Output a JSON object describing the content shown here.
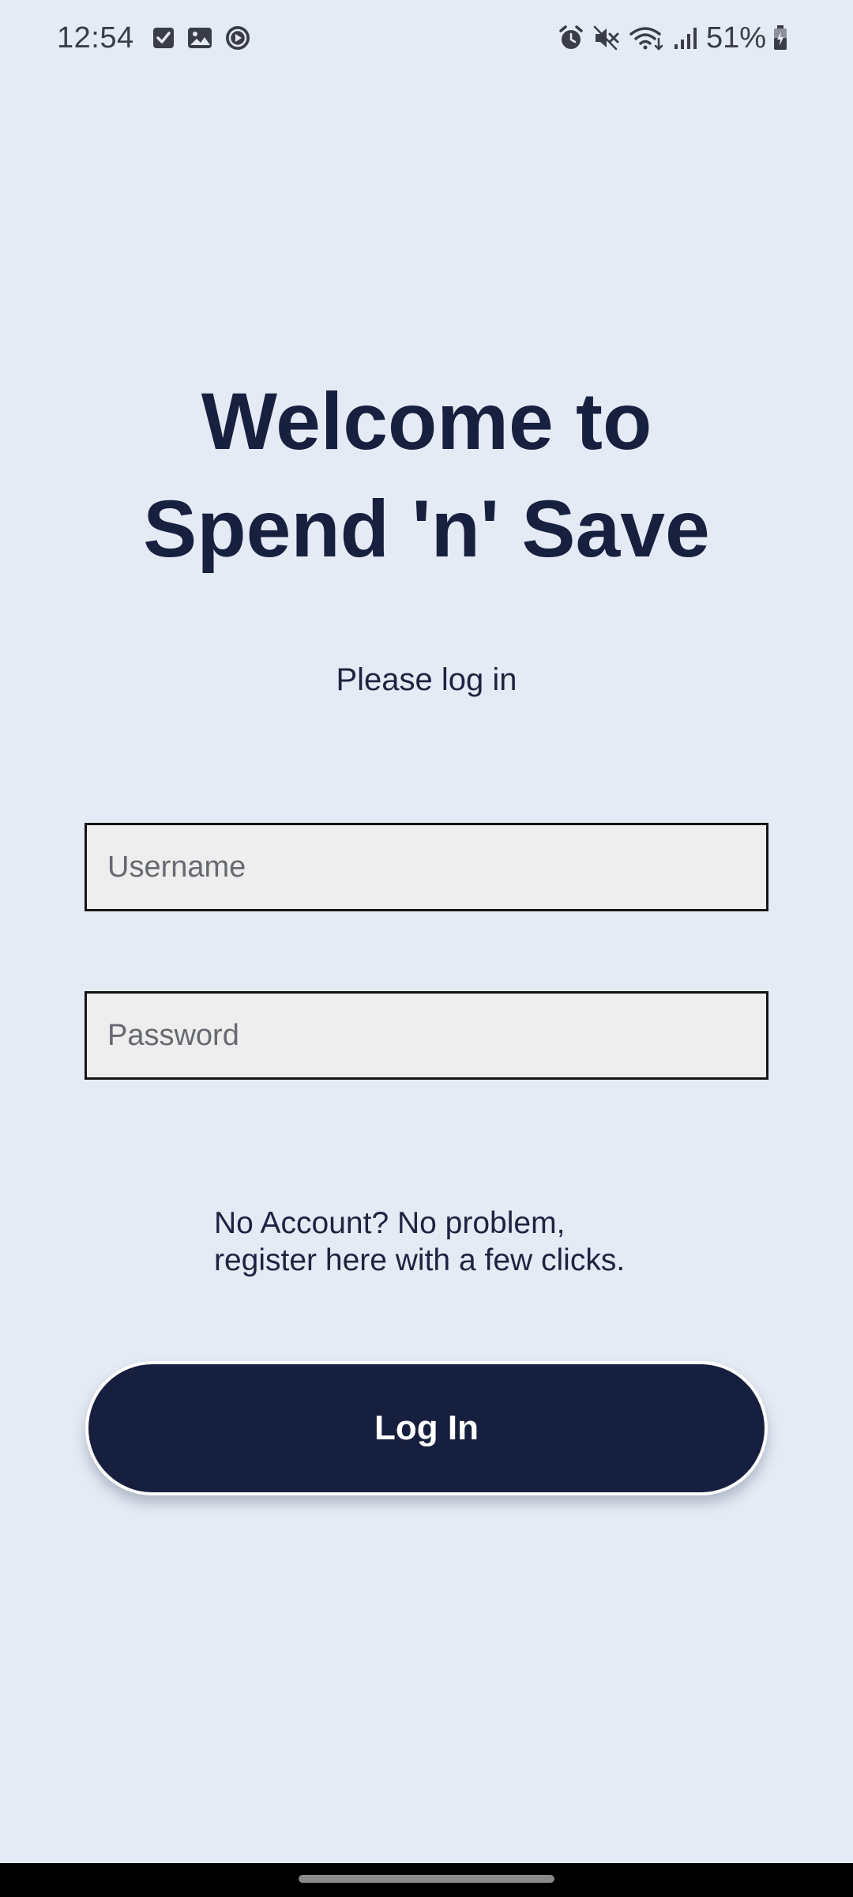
{
  "status_bar": {
    "time": "12:54",
    "battery_percent": "51%",
    "left_icons": [
      "checkbox-icon",
      "image-icon",
      "play-circle-icon"
    ],
    "right_icons": [
      "alarm-icon",
      "mute-icon",
      "wifi-icon",
      "signal-icon",
      "battery-icon"
    ]
  },
  "welcome": {
    "line1": "Welcome to",
    "line2": "Spend 'n' Save"
  },
  "subtitle": "Please log in",
  "username": {
    "placeholder": "Username",
    "value": ""
  },
  "password": {
    "placeholder": "Password",
    "value": ""
  },
  "register": {
    "line1": "No Account? No problem,",
    "line2": "register here with a few clicks."
  },
  "login_button": {
    "label": "Log In"
  },
  "colors": {
    "background": "#e5ebf5",
    "primary": "#171f3e",
    "field_background": "#eeeeee"
  }
}
